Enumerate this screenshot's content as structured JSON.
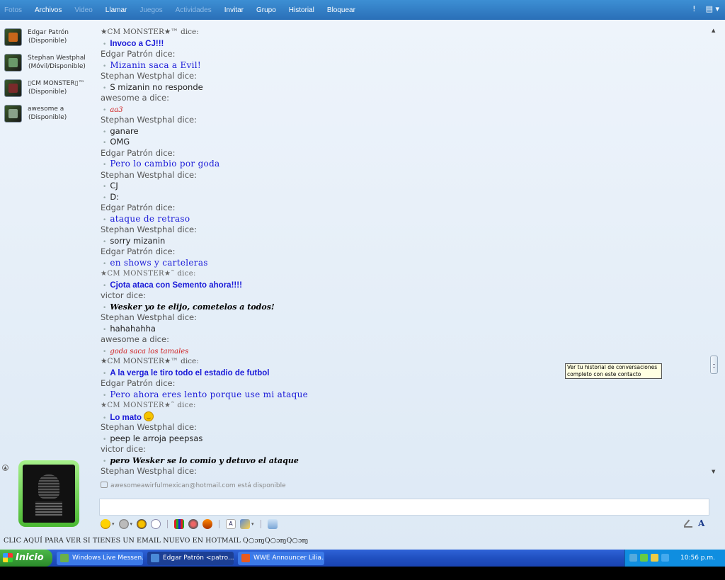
{
  "menu": {
    "items": [
      {
        "label": "Fotos",
        "dim": true
      },
      {
        "label": "Archivos",
        "dim": false
      },
      {
        "label": "Video",
        "dim": true
      },
      {
        "label": "Llamar",
        "dim": false
      },
      {
        "label": "Juegos",
        "dim": true
      },
      {
        "label": "Actividades",
        "dim": true
      },
      {
        "label": "Invitar",
        "dim": false
      },
      {
        "label": "Grupo",
        "dim": false
      },
      {
        "label": "Historial",
        "dim": false
      },
      {
        "label": "Bloquear",
        "dim": false
      }
    ]
  },
  "contacts": [
    {
      "name": "Edgar Patrón",
      "status": "(Disponible)"
    },
    {
      "name": "Stephan Westphal",
      "status": "(Móvil/Disponible)"
    },
    {
      "name": "▯CM MONSTER▯™",
      "status": "(Disponible)"
    },
    {
      "name": "awesome a",
      "status": "(Disponible)"
    }
  ],
  "chat": {
    "messages": [
      {
        "sender": "★CM MONSTER★™ dice:",
        "sender_style": "serif",
        "lines": [
          {
            "text": "Invoco a CJ!!!",
            "style": "t-blue-bold"
          }
        ]
      },
      {
        "sender": "Edgar Patrón dice:",
        "sender_style": "",
        "lines": [
          {
            "text": "Mizanin saca a Evil!",
            "style": "t-blue-serif"
          }
        ]
      },
      {
        "sender": "Stephan Westphal dice:",
        "sender_style": "",
        "lines": [
          {
            "text": "S mizanin no responde",
            "style": "t-plain"
          }
        ]
      },
      {
        "sender": "awesome a dice:",
        "sender_style": "",
        "lines": [
          {
            "text": "aa3",
            "style": "t-red-italic"
          }
        ]
      },
      {
        "sender": "Stephan Westphal dice:",
        "sender_style": "",
        "lines": [
          {
            "text": "ganare",
            "style": "t-plain"
          },
          {
            "text": "OMG",
            "style": "t-plain"
          }
        ]
      },
      {
        "sender": "Edgar Patrón dice:",
        "sender_style": "",
        "lines": [
          {
            "text": "Pero lo cambio por goda",
            "style": "t-blue-serif"
          }
        ]
      },
      {
        "sender": "Stephan Westphal dice:",
        "sender_style": "",
        "lines": [
          {
            "text": "CJ",
            "style": "t-plain"
          },
          {
            "text": "D:",
            "style": "t-plain"
          }
        ]
      },
      {
        "sender": "Edgar Patrón dice:",
        "sender_style": "",
        "lines": [
          {
            "text": "ataque de retraso",
            "style": "t-blue-serif"
          }
        ]
      },
      {
        "sender": "Stephan Westphal dice:",
        "sender_style": "",
        "lines": [
          {
            "text": "sorry mizanin",
            "style": "t-plain"
          }
        ]
      },
      {
        "sender": "Edgar Patrón dice:",
        "sender_style": "",
        "lines": [
          {
            "text": "en shows y carteleras",
            "style": "t-blue-serif"
          }
        ]
      },
      {
        "sender": "★CM MONSTER★˜ dice:",
        "sender_style": "fancy",
        "lines": [
          {
            "text": "Cjota ataca con Semento ahora!!!!",
            "style": "t-blue-bold"
          }
        ]
      },
      {
        "sender": "victor dice:",
        "sender_style": "",
        "lines": [
          {
            "text": "Wesker yo te elijo, cometelos a todos!",
            "style": "t-black-bold-italic"
          }
        ]
      },
      {
        "sender": "Stephan Westphal dice:",
        "sender_style": "",
        "lines": [
          {
            "text": "hahahahha",
            "style": "t-plain"
          }
        ]
      },
      {
        "sender": "awesome a dice:",
        "sender_style": "",
        "lines": [
          {
            "text": "goda saca los tamales",
            "style": "t-red-italic"
          }
        ]
      },
      {
        "sender": "★CM MONSTER★™ dice:",
        "sender_style": "serif",
        "lines": [
          {
            "text": "A la verga le tiro todo el estadio de futbol",
            "style": "t-blue-bold"
          }
        ]
      },
      {
        "sender": "Edgar Patrón dice:",
        "sender_style": "",
        "lines": [
          {
            "text": "Pero ahora eres lento porque use mi ataque",
            "style": "t-blue-serif"
          }
        ]
      },
      {
        "sender": "★CM MONSTER★˜ dice:",
        "sender_style": "fancy",
        "lines": [
          {
            "text": "Lo mato",
            "style": "t-blue-bold",
            "emoticon": true
          }
        ]
      },
      {
        "sender": "Stephan Westphal dice:",
        "sender_style": "",
        "lines": [
          {
            "text": "peep le arroja peepsas",
            "style": "t-plain"
          }
        ]
      },
      {
        "sender": "victor dice:",
        "sender_style": "",
        "lines": [
          {
            "text": "pero Wesker se lo comio y detuvo el ataque",
            "style": "t-black-bold-italic"
          }
        ]
      },
      {
        "sender": "Stephan Westphal dice:",
        "sender_style": "",
        "lines": []
      }
    ],
    "status_notice": "awesomeawirfulmexican@hotmail.com está disponible"
  },
  "tooltip": {
    "text": "Ver tu historial de conversaciones completo con este contacto"
  },
  "ad": {
    "text": "CLIC AQUÍ PARA VER SI TIENES UN EMAIL NUEVO EN HOTMAIL  Q○ɔɱQ○ɔɱQ○ɔɱ"
  },
  "taskbar": {
    "start_label": "Inicio",
    "tasks": [
      {
        "label": "Windows Live Messen...",
        "active": false,
        "icon_color": "#6ab04a"
      },
      {
        "label": "Edgar Patrón <patro...",
        "active": true,
        "icon_color": "#4a8ad8"
      },
      {
        "label": "WWE Announcer Lilia...",
        "active": false,
        "icon_color": "#e85a20"
      }
    ],
    "clock": "10:56 p.m."
  },
  "colors": {
    "titlebar": "#2f7bc6",
    "taskbar": "#2050c0",
    "start": "#3a9a3a"
  }
}
